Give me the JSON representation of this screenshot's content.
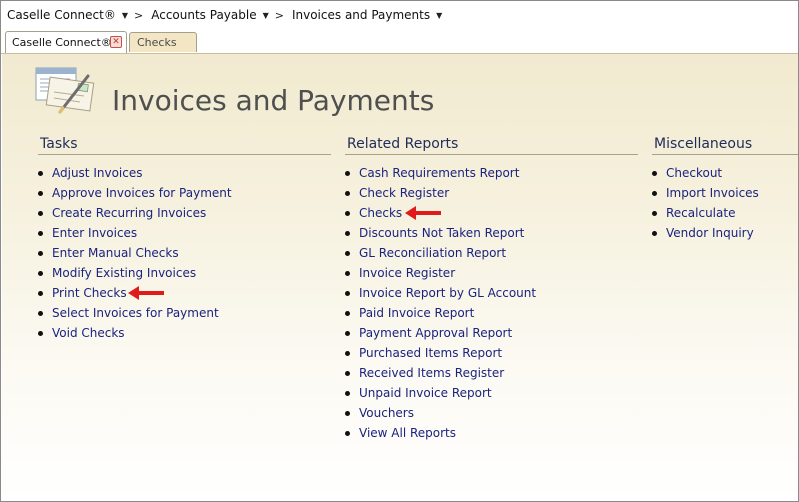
{
  "breadcrumbs": [
    {
      "label": "Caselle Connect®",
      "has_dropdown": true
    },
    {
      "label": "Accounts Payable",
      "has_dropdown": true
    },
    {
      "label": "Invoices and Payments",
      "has_dropdown": true
    }
  ],
  "breadcrumb_separator": ">",
  "tabs": [
    {
      "label": "Caselle Connect®",
      "active": true,
      "closable": true
    },
    {
      "label": "Checks",
      "active": false
    }
  ],
  "page": {
    "title": "Invoices and Payments",
    "icon": "invoices-payments-icon"
  },
  "sections": {
    "tasks": {
      "heading": "Tasks",
      "items": [
        "Adjust Invoices",
        "Approve Invoices for Payment",
        "Create Recurring Invoices",
        "Enter Invoices",
        "Enter Manual Checks",
        "Modify Existing Invoices",
        "Print Checks",
        "Select Invoices for Payment",
        "Void Checks"
      ]
    },
    "reports": {
      "heading": "Related Reports",
      "items": [
        "Cash Requirements Report",
        "Check Register",
        "Checks",
        "Discounts Not Taken Report",
        "GL Reconciliation Report",
        "Invoice Register",
        "Invoice Report by GL Account",
        "Paid Invoice Report",
        "Payment Approval Report",
        "Purchased Items Report",
        "Received Items Register",
        "Unpaid Invoice Report",
        "Vouchers",
        "View All Reports"
      ]
    },
    "misc": {
      "heading": "Miscellaneous",
      "items": [
        "Checkout",
        "Import Invoices",
        "Recalculate",
        "Vendor Inquiry"
      ]
    }
  },
  "annotations": [
    {
      "points_to": "Print Checks",
      "color": "#e01b1b"
    },
    {
      "points_to": "Checks",
      "color": "#e01b1b"
    }
  ],
  "colors": {
    "link": "#1a237e",
    "heading": "#1f2c57",
    "arrow": "#e01b1b",
    "tab_inactive_bg": "#f2e6c4"
  }
}
